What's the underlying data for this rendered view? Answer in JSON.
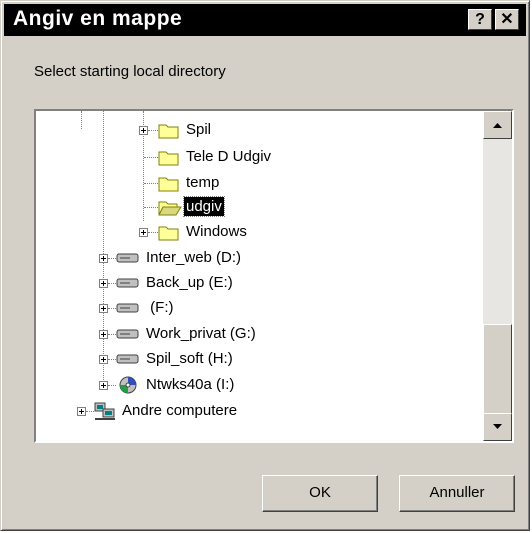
{
  "window": {
    "title": "Angiv en mappe",
    "help_glyph": "?",
    "close_glyph": "✕"
  },
  "prompt": "Select starting local directory",
  "tree": {
    "items": [
      {
        "label": "Spil",
        "icon": "folder-icon",
        "expandable": true
      },
      {
        "label": "Tele D Udgiv",
        "icon": "folder-icon",
        "expandable": false
      },
      {
        "label": "temp",
        "icon": "folder-icon",
        "expandable": false
      },
      {
        "label": "udgiv",
        "icon": "folder-open-icon",
        "expandable": false,
        "selected": true
      },
      {
        "label": "Windows",
        "icon": "folder-icon",
        "expandable": true
      },
      {
        "label": "Inter_web (D:)",
        "icon": "drive-icon",
        "expandable": true
      },
      {
        "label": "Back_up (E:)",
        "icon": "drive-icon",
        "expandable": true
      },
      {
        "label": " (F:)",
        "icon": "drive-icon",
        "expandable": true
      },
      {
        "label": "Work_privat (G:)",
        "icon": "drive-icon",
        "expandable": true
      },
      {
        "label": "Spil_soft (H:)",
        "icon": "drive-icon",
        "expandable": true
      },
      {
        "label": "Ntwks40a (I:)",
        "icon": "cdrom-icon",
        "expandable": true
      },
      {
        "label": "Andre computere",
        "icon": "network-computers-icon",
        "expandable": true
      }
    ]
  },
  "buttons": {
    "ok": "OK",
    "cancel": "Annuller"
  },
  "colors": {
    "face": "#d4d0c8",
    "titlebar": "#000000",
    "selection": "#000000",
    "folder": "#ffff99"
  }
}
